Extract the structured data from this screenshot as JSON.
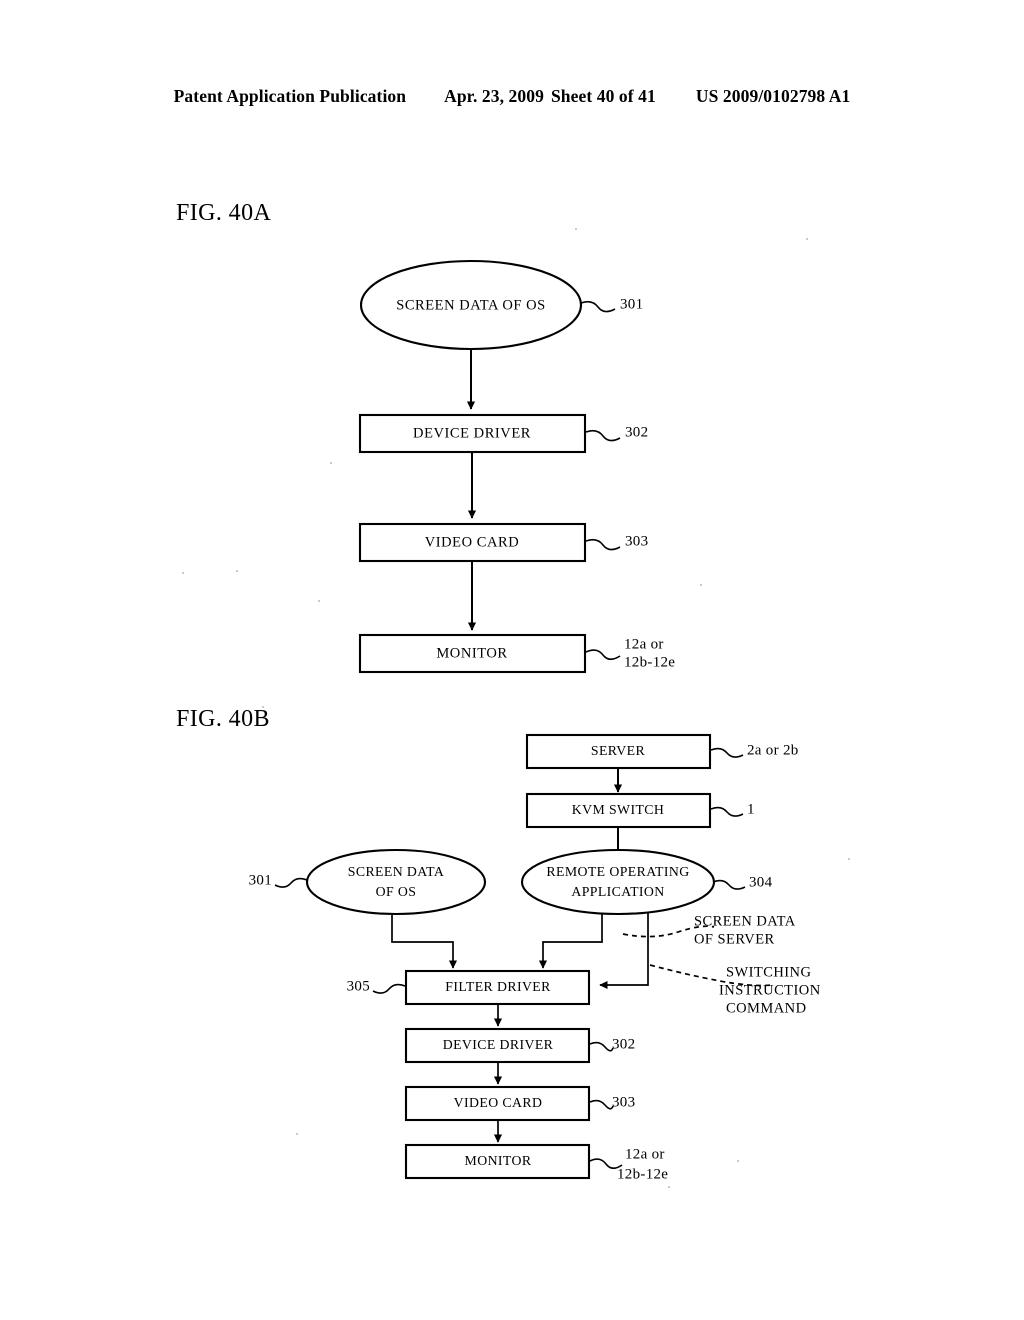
{
  "header": {
    "publication": "Patent Application Publication",
    "date": "Apr. 23, 2009",
    "sheet": "Sheet 40 of 41",
    "patent_number": "US 2009/0102798 A1"
  },
  "figures": [
    {
      "id": "fig-40a",
      "label": "FIG. 40A",
      "nodes": [
        {
          "key": "os",
          "shape": "ellipse",
          "text": "SCREEN DATA OF OS",
          "ref": "301"
        },
        {
          "key": "devdrv",
          "shape": "box",
          "text": "DEVICE DRIVER",
          "ref": "302"
        },
        {
          "key": "video",
          "shape": "box",
          "text": "VIDEO CARD",
          "ref": "303"
        },
        {
          "key": "monitor",
          "shape": "box",
          "text": "MONITOR",
          "ref": "12a or",
          "ref_line2": "12b-12e"
        }
      ]
    },
    {
      "id": "fig-40b",
      "label": "FIG. 40B",
      "nodes": [
        {
          "key": "server",
          "shape": "box",
          "text": "SERVER",
          "ref": "2a or 2b"
        },
        {
          "key": "kvm",
          "shape": "box",
          "text": "KVM SWITCH",
          "ref": "1"
        },
        {
          "key": "os",
          "shape": "ellipse",
          "text_line1": "SCREEN DATA",
          "text_line2": "OF OS",
          "ref": "301"
        },
        {
          "key": "remote",
          "shape": "ellipse",
          "text_line1": "REMOTE OPERATING",
          "text_line2": "APPLICATION",
          "ref": "304"
        },
        {
          "key": "filter",
          "shape": "box",
          "text": "FILTER DRIVER",
          "ref": "305"
        },
        {
          "key": "devdrv",
          "shape": "box",
          "text": "DEVICE DRIVER",
          "ref": "302"
        },
        {
          "key": "video",
          "shape": "box",
          "text": "VIDEO CARD",
          "ref": "303"
        },
        {
          "key": "monitor",
          "shape": "box",
          "text": "MONITOR",
          "ref": "12a or",
          "ref_line2": "12b-12e"
        }
      ],
      "annotations": [
        {
          "key": "screen_data_server",
          "line1": "SCREEN DATA",
          "line2": "OF SERVER",
          "line3": ""
        },
        {
          "key": "switching_command",
          "line1": "SWITCHING",
          "line2": "INSTRUCTION",
          "line3": "COMMAND"
        }
      ]
    }
  ],
  "colors": {
    "ink": "#000000",
    "paper": "#ffffff"
  }
}
